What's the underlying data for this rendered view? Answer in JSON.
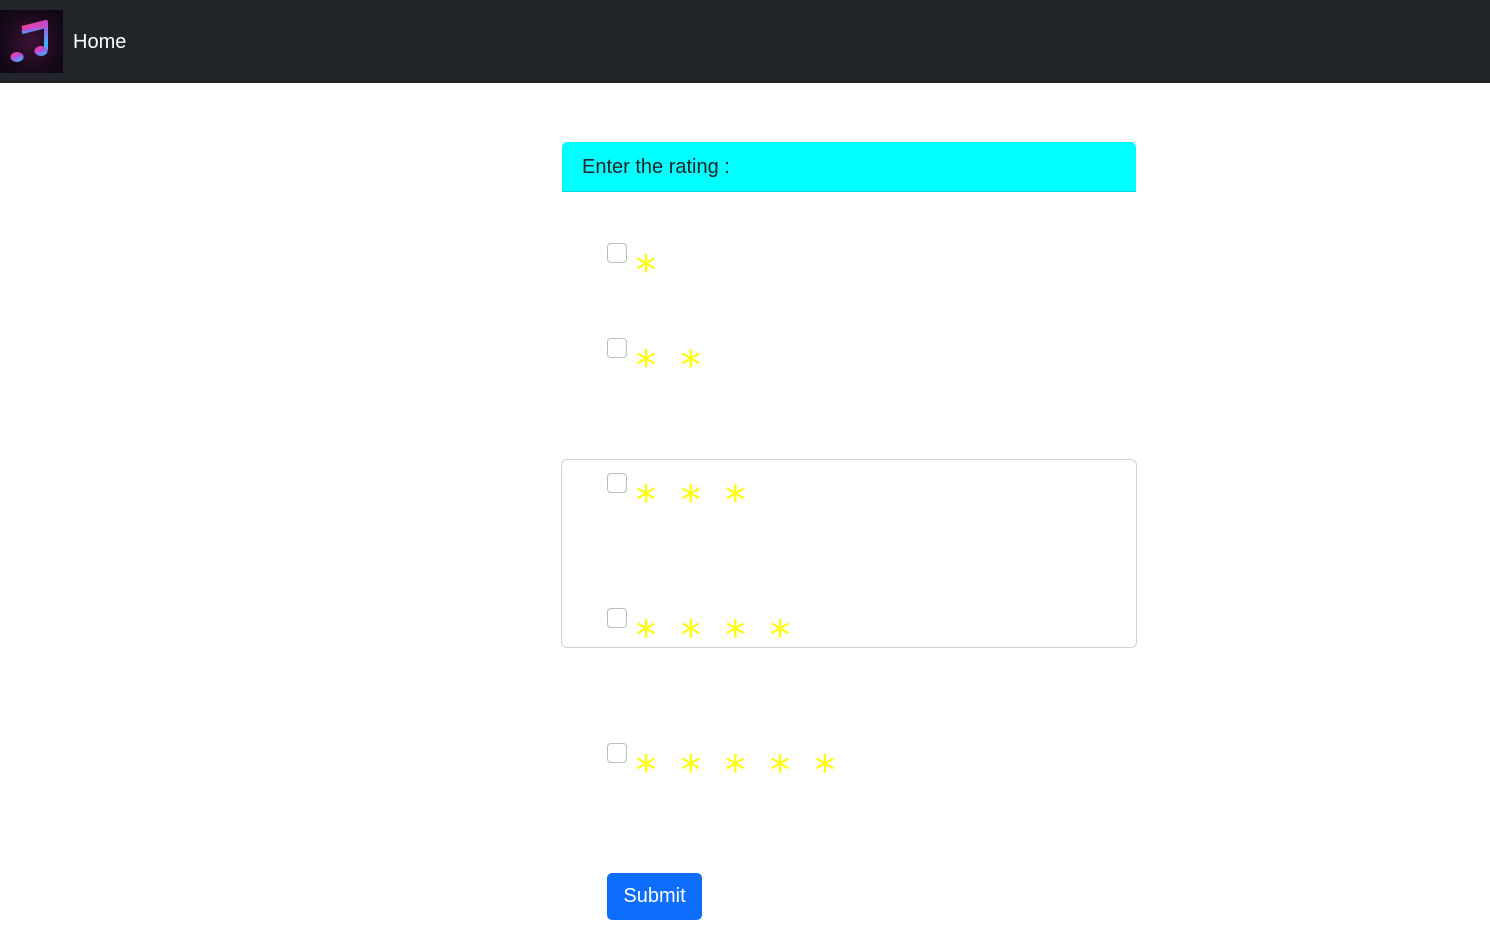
{
  "nav": {
    "home_label": "Home",
    "logo_icon": "music-note-icon"
  },
  "form": {
    "header": "Enter the rating :",
    "options": [
      {
        "stars": "* ",
        "rating": 1
      },
      {
        "stars": "* * ",
        "rating": 2
      },
      {
        "stars": "* * * ",
        "rating": 3
      },
      {
        "stars": "* * * * ",
        "rating": 4
      },
      {
        "stars": "* * * * * ",
        "rating": 5
      }
    ],
    "submit_label": "Submit"
  },
  "colors": {
    "navbar": "#212529",
    "header_bg": "#00ffff",
    "star": "#ffff00",
    "button": "#0d6efd"
  }
}
